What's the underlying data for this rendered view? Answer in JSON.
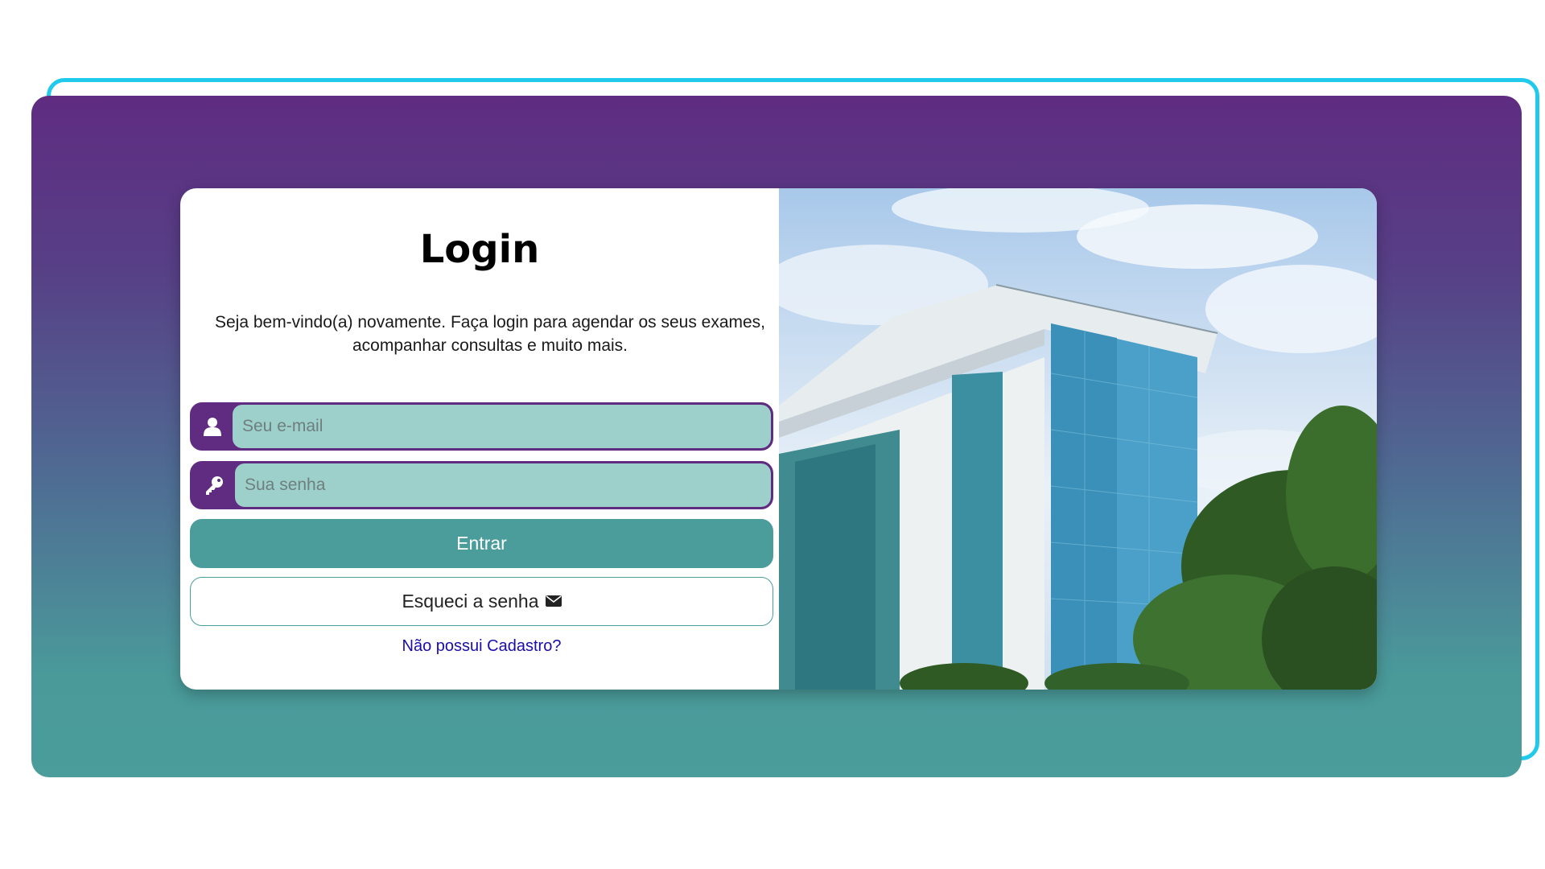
{
  "login": {
    "title": "Login",
    "subtitle": "Seja bem-vindo(a) novamente. Faça login para agendar os seus exames, acompanhar consultas e muito mais.",
    "email_placeholder": "Seu e-mail",
    "password_placeholder": "Sua senha",
    "submit_label": "Entrar",
    "forgot_label": "Esqueci a senha",
    "register_link": "Não possui Cadastro?"
  },
  "icons": {
    "email_addon": "user-icon",
    "password_addon": "key-icon",
    "forgot": "envelope-icon"
  },
  "colors": {
    "purple": "#5f2c82",
    "teal": "#4a9d9b",
    "input_bg": "#9dd0cb",
    "frame_outline": "#21c9ec",
    "link": "#1a0dab"
  }
}
